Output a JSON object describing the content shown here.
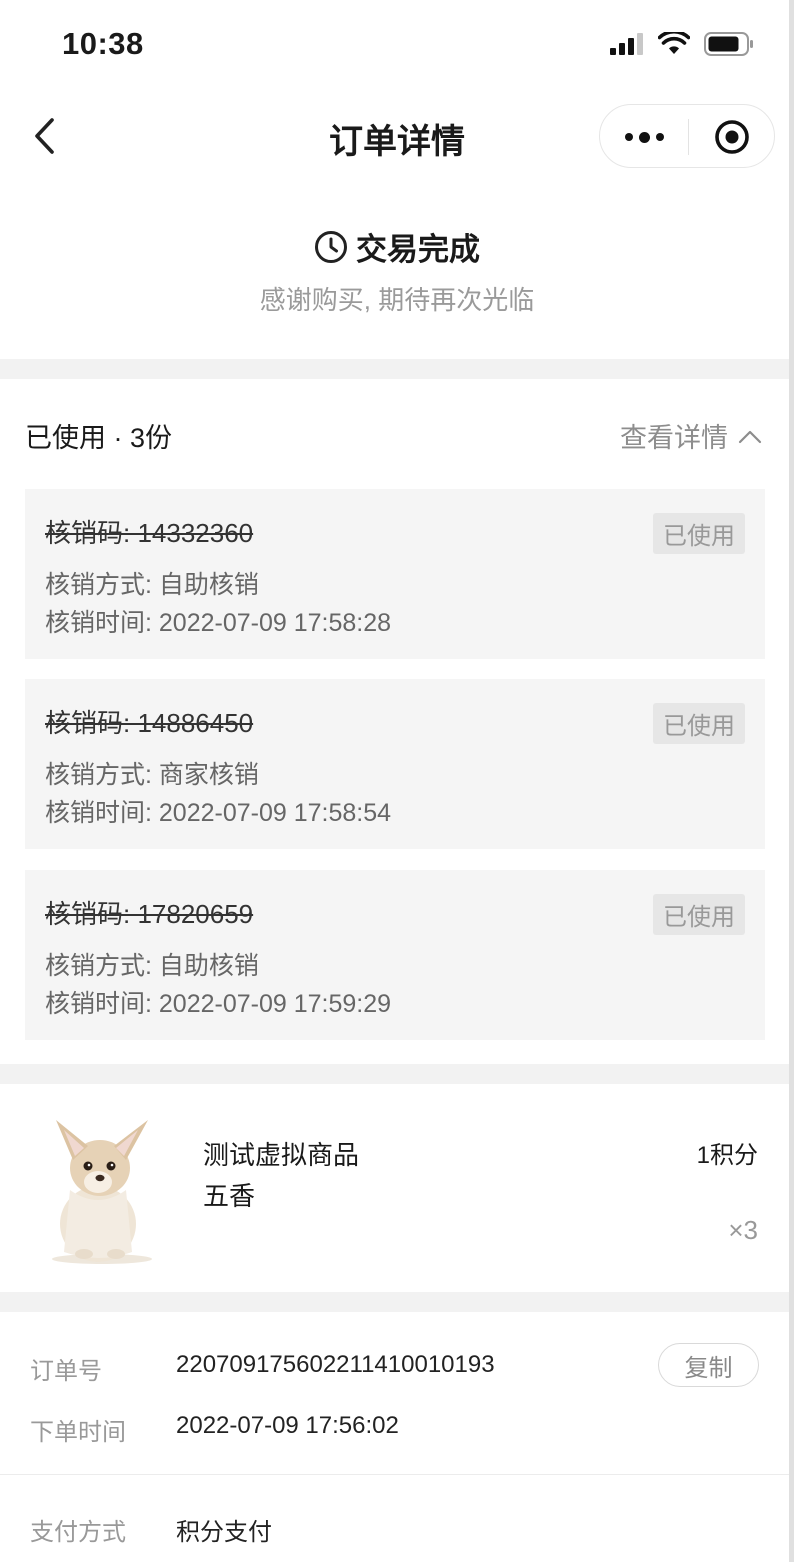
{
  "status_bar": {
    "time": "10:38"
  },
  "nav": {
    "title": "订单详情"
  },
  "order_status": {
    "title": "交易完成",
    "subtitle": "感谢购买, 期待再次光临"
  },
  "redemption": {
    "summary": "已使用 · 3份",
    "view_detail": "查看详情",
    "items": [
      {
        "code": "核销码: 14332360",
        "badge": "已使用",
        "method": "核销方式: 自助核销",
        "time": "核销时间: 2022-07-09 17:58:28"
      },
      {
        "code": "核销码: 14886450",
        "badge": "已使用",
        "method": "核销方式: 商家核销",
        "time": "核销时间: 2022-07-09 17:58:54"
      },
      {
        "code": "核销码: 17820659",
        "badge": "已使用",
        "method": "核销方式: 自助核销",
        "time": "核销时间: 2022-07-09 17:59:29"
      }
    ]
  },
  "product": {
    "name": "测试虚拟商品",
    "spec": "五香",
    "price": "1积分",
    "quantity": "×3"
  },
  "order_info": {
    "order_no_label": "订单号",
    "order_no": "220709175602211410010193",
    "copy_label": "复制",
    "order_time_label": "下单时间",
    "order_time": "2022-07-09 17:56:02",
    "payment_label": "支付方式",
    "payment": "积分支付"
  }
}
